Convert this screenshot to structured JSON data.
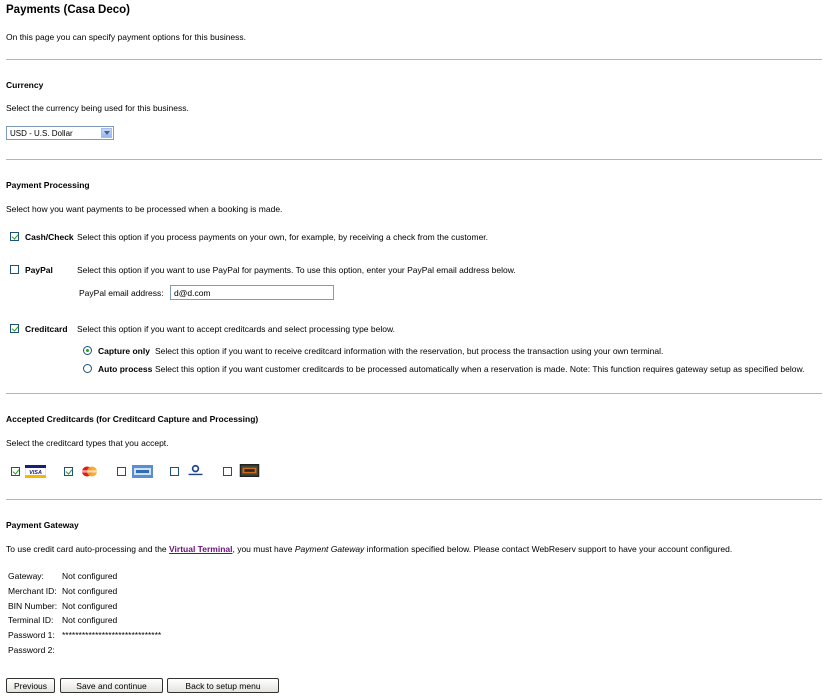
{
  "page": {
    "title": "Payments (Casa Deco)",
    "intro": "On this page you can specify payment options for this business."
  },
  "currency": {
    "heading": "Currency",
    "description": "Select the currency being used for this business.",
    "selected": "USD - U.S. Dollar"
  },
  "processing": {
    "heading": "Payment Processing",
    "description": "Select how you want payments to be processed when a booking is made.",
    "cash": {
      "label": "Cash/Check",
      "checked": true,
      "text": "Select this option if you process payments on your own, for example, by receiving a check from the customer."
    },
    "paypal": {
      "label": "PayPal",
      "checked": false,
      "text": "Select this option if you want to use PayPal for payments. To use this option, enter your PayPal email address below.",
      "email_label": "PayPal email address:",
      "email_value": "d@d.com"
    },
    "creditcard": {
      "label": "Creditcard",
      "checked": true,
      "text": "Select this option if you want to accept creditcards and select processing type below.",
      "capture_label": "Capture only",
      "capture_text": "Select this option if you want to receive creditcard information with the reservation, but process the transaction using your own terminal.",
      "auto_label": "Auto process",
      "auto_text": "Select this option if you want customer creditcards to be processed automatically when a reservation is made. Note: This function requires gateway setup as specified below.",
      "selected_mode": "capture"
    }
  },
  "cards": {
    "heading": "Accepted Creditcards (for Creditcard Capture and Processing)",
    "description": "Select the creditcard types that you accept.",
    "items": [
      {
        "name": "visa",
        "checked": true
      },
      {
        "name": "mastercard",
        "checked": true
      },
      {
        "name": "amex",
        "checked": false
      },
      {
        "name": "diners",
        "checked": false
      },
      {
        "name": "discover",
        "checked": false
      }
    ]
  },
  "gateway": {
    "heading": "Payment Gateway",
    "text_before": "To use credit card auto-processing and the ",
    "link": "Virtual Terminal",
    "text_middle": ", you must have ",
    "text_italic": "Payment Gateway",
    "text_after": " information specified below. Please contact WebReserv support to have your account configured.",
    "rows": [
      {
        "label": "Gateway:",
        "value": "Not configured"
      },
      {
        "label": "Merchant ID:",
        "value": "Not configured"
      },
      {
        "label": "BIN Number:",
        "value": "Not configured"
      },
      {
        "label": "Terminal ID:",
        "value": "Not configured"
      },
      {
        "label": "Password 1:",
        "value": "******************************"
      },
      {
        "label": "Password 2:",
        "value": ""
      }
    ]
  },
  "buttons": {
    "previous": "Previous",
    "save": "Save and continue",
    "back": "Back to setup menu"
  }
}
